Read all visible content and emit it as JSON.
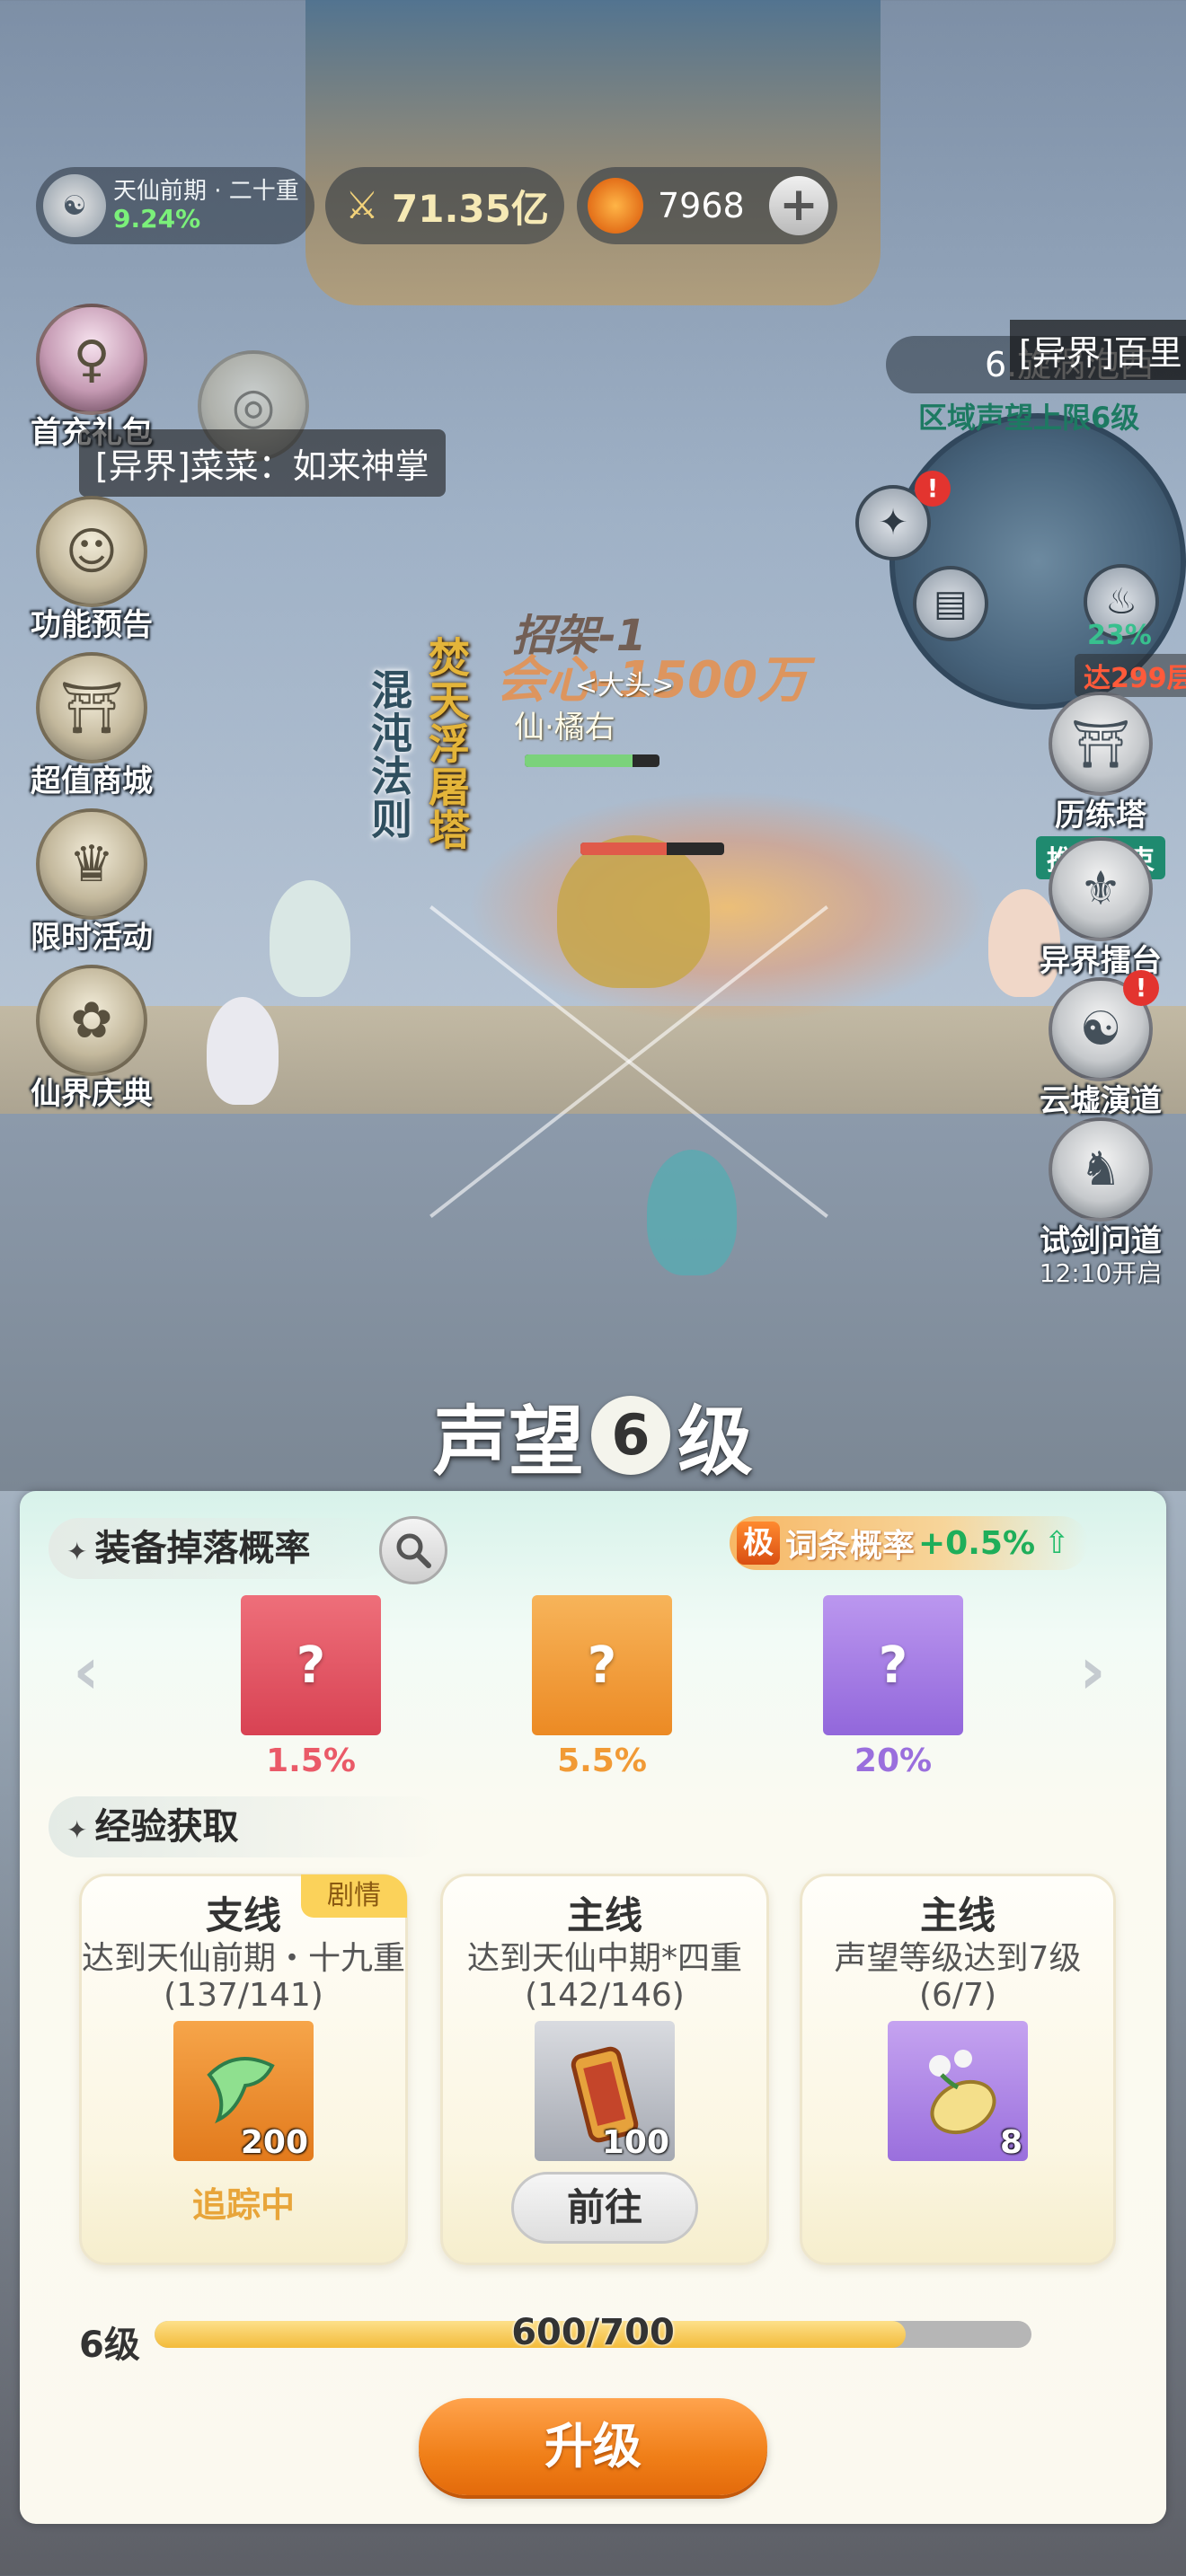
{
  "hud": {
    "realm_name": "天仙前期 · 二十重",
    "realm_percent": "9.24%",
    "power": "71.35亿",
    "currency": "7968",
    "add_label": "+"
  },
  "left_menu": [
    {
      "label": "首充礼包",
      "icon": "gift-character-icon"
    },
    {
      "label": "功能预告",
      "icon": "preview-icon"
    },
    {
      "label": "超值商城",
      "icon": "shop-icon"
    },
    {
      "label": "限时活动",
      "icon": "event-icon"
    },
    {
      "label": "仙界庆典",
      "icon": "celebration-icon"
    }
  ],
  "chat": {
    "message": "[异界]菜菜：如来神掌"
  },
  "top_banner": "[异界]百里",
  "minimap": {
    "zone": "6.旋涡泡西",
    "reputation_limit": "区域声望上限6级",
    "percent": "23%",
    "reached": "达299层"
  },
  "right_menu": [
    {
      "label": "历练塔",
      "tag": "推关结束"
    },
    {
      "label": "异界擂台"
    },
    {
      "label": "云墟演道"
    },
    {
      "label": "试剑问道",
      "sub": "12:10开启"
    }
  ],
  "battle": {
    "vertical_1": "混沌法则",
    "vertical_2": "焚天浮屠塔",
    "block_text": "招架-1",
    "damage_text": "会心-1500万",
    "name_1": "仙·橘右",
    "name_2": "<大头>"
  },
  "panel": {
    "title_prefix": "声望",
    "level": "6",
    "title_suffix": "级",
    "drop_section": "装备掉落概率",
    "affix_badge": "极",
    "affix_label": "词条概率",
    "affix_value": "+0.5%",
    "equip_slots": [
      {
        "percent": "1.5%",
        "color": "#e45563",
        "pct_color": "#ea5a68"
      },
      {
        "percent": "5.5%",
        "color": "#f19a35",
        "pct_color": "#f19a35"
      },
      {
        "percent": "20%",
        "color": "#a27ae3",
        "pct_color": "#9a6fdd"
      }
    ],
    "exp_section": "经验获取",
    "tasks": [
      {
        "type": "支线",
        "badge": "剧情",
        "desc": "达到天仙前期・十九重",
        "progress": "(137/141)",
        "count": "200",
        "state": "追踪中"
      },
      {
        "type": "主线",
        "desc": "达到天仙中期*四重",
        "progress": "(142/146)",
        "count": "100",
        "button": "前往"
      },
      {
        "type": "主线",
        "desc": "声望等级达到7级",
        "progress": "(6/7)",
        "count": "8"
      }
    ],
    "bar_level": "6级",
    "bar_text": "600/700",
    "bar_fraction": 0.857,
    "upgrade": "升级"
  }
}
